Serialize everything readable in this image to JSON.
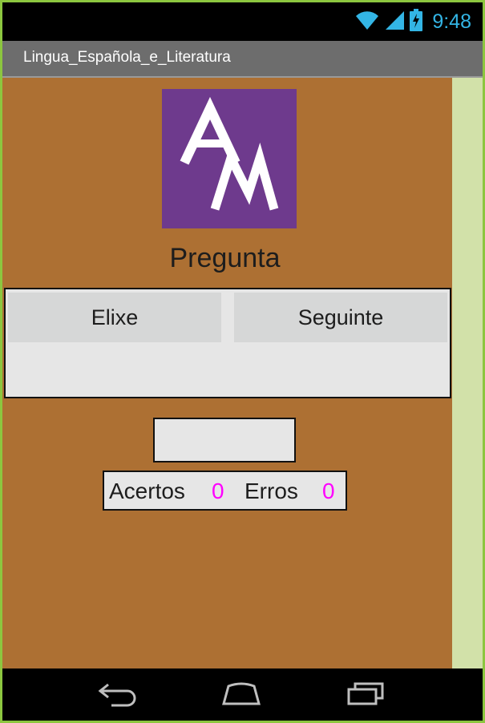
{
  "status_bar": {
    "time": "9:48",
    "icons": [
      "wifi-icon",
      "signal-icon",
      "battery-charging-icon"
    ]
  },
  "app_title": "Lingua_Española_e_Literatura",
  "logo": {
    "text": "AM",
    "bg_color": "#6e3a8d"
  },
  "question_label": "Pregunta",
  "buttons": {
    "choose_label": "Elixe",
    "next_label": "Seguinte"
  },
  "answer_box": {
    "value": ""
  },
  "score": {
    "correct_label": "Acertos",
    "correct_value": "0",
    "errors_label": "Erros",
    "errors_value": "0"
  },
  "nav_bar": {
    "icons": [
      "back-icon",
      "home-icon",
      "recent-apps-icon"
    ]
  },
  "colors": {
    "background": "#ad7033",
    "accent_status": "#33b5e5",
    "score_value": "#ff00ff",
    "side_strip": "#d2e1a9",
    "frame_border": "#8cc63f"
  }
}
